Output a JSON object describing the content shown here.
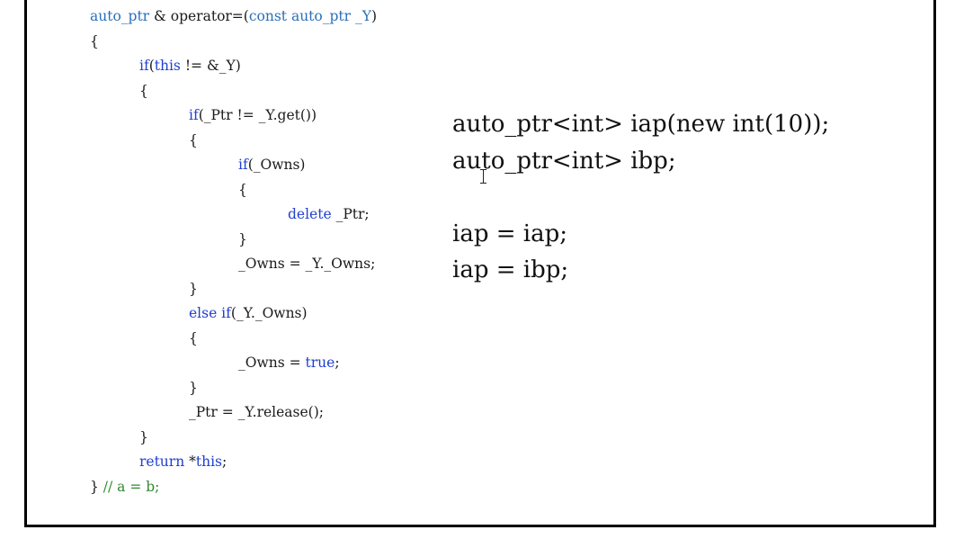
{
  "code_lines": [
    {
      "indent": 0,
      "parts": [
        {
          "t": "auto_ptr",
          "c": "ty"
        },
        {
          "t": " & operator=(",
          "c": "plain"
        },
        {
          "t": "const auto_ptr _Y",
          "c": "ty"
        },
        {
          "t": ")",
          "c": "plain"
        }
      ]
    },
    {
      "indent": 0,
      "parts": [
        {
          "t": "{",
          "c": "plain"
        }
      ]
    },
    {
      "indent": 1,
      "parts": [
        {
          "t": "if",
          "c": "kw"
        },
        {
          "t": "(",
          "c": "plain"
        },
        {
          "t": "this",
          "c": "kw"
        },
        {
          "t": " != &_Y)",
          "c": "plain"
        }
      ]
    },
    {
      "indent": 1,
      "parts": [
        {
          "t": "{",
          "c": "plain"
        }
      ]
    },
    {
      "indent": 2,
      "parts": [
        {
          "t": "if",
          "c": "kw"
        },
        {
          "t": "(_Ptr != _Y.get())",
          "c": "plain"
        }
      ]
    },
    {
      "indent": 2,
      "parts": [
        {
          "t": "{",
          "c": "plain"
        }
      ]
    },
    {
      "indent": 3,
      "parts": [
        {
          "t": "if",
          "c": "kw"
        },
        {
          "t": "(_Owns)",
          "c": "plain"
        }
      ]
    },
    {
      "indent": 3,
      "parts": [
        {
          "t": "{",
          "c": "plain"
        }
      ]
    },
    {
      "indent": 4,
      "parts": [
        {
          "t": "delete",
          "c": "kw"
        },
        {
          "t": " _Ptr;",
          "c": "plain"
        }
      ]
    },
    {
      "indent": 3,
      "parts": [
        {
          "t": "}",
          "c": "plain"
        }
      ]
    },
    {
      "indent": 3,
      "parts": [
        {
          "t": "_Owns = _Y._Owns;",
          "c": "plain"
        }
      ]
    },
    {
      "indent": 2,
      "parts": [
        {
          "t": "}",
          "c": "plain"
        }
      ]
    },
    {
      "indent": 2,
      "parts": [
        {
          "t": "else if",
          "c": "kw"
        },
        {
          "t": "(_Y._Owns)",
          "c": "plain"
        }
      ]
    },
    {
      "indent": 2,
      "parts": [
        {
          "t": "{",
          "c": "plain"
        }
      ]
    },
    {
      "indent": 3,
      "parts": [
        {
          "t": "_Owns = ",
          "c": "plain"
        },
        {
          "t": "true",
          "c": "kw"
        },
        {
          "t": ";",
          "c": "plain"
        }
      ]
    },
    {
      "indent": 2,
      "parts": [
        {
          "t": "}",
          "c": "plain"
        }
      ]
    },
    {
      "indent": 2,
      "parts": [
        {
          "t": "_Ptr = _Y.release();",
          "c": "plain"
        }
      ]
    },
    {
      "indent": 1,
      "parts": [
        {
          "t": "}",
          "c": "plain"
        }
      ]
    },
    {
      "indent": 1,
      "parts": [
        {
          "t": "return",
          "c": "kw"
        },
        {
          "t": " *",
          "c": "plain"
        },
        {
          "t": "this",
          "c": "kw"
        },
        {
          "t": ";",
          "c": "plain"
        }
      ]
    },
    {
      "indent": 0,
      "parts": [
        {
          "t": "} ",
          "c": "plain"
        },
        {
          "t": "// a = b;",
          "c": "cm"
        }
      ]
    }
  ],
  "demo_lines": [
    "auto_ptr<int> iap(new int(10));",
    "auto_ptr<int> ibp;",
    "",
    "iap = iap;",
    "iap = ibp;"
  ],
  "colors": {
    "keyword": "#1f3fd0",
    "type": "#2a6fb8",
    "comment": "#2e8b2e",
    "text": "#1a1a1a"
  },
  "cursor_icon": "text-cursor-icon"
}
